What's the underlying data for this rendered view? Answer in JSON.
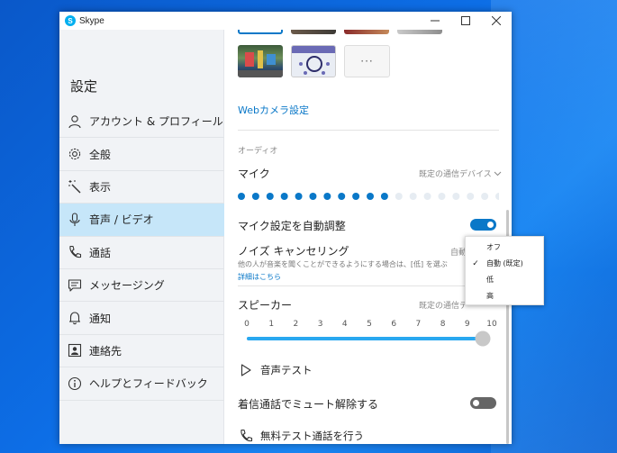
{
  "window": {
    "title": "Skype",
    "logo_letter": "S",
    "controls": {
      "minimize": "—",
      "maximize": "☐",
      "close": "✕"
    }
  },
  "sidebar": {
    "title": "設定",
    "items": [
      {
        "label": "アカウント & プロフィール",
        "icon": "person-icon",
        "active": false
      },
      {
        "label": "全般",
        "icon": "gear-icon",
        "active": false
      },
      {
        "label": "表示",
        "icon": "magic-wand-icon",
        "active": false
      },
      {
        "label": "音声 / ビデオ",
        "icon": "microphone-icon",
        "active": true
      },
      {
        "label": "通話",
        "icon": "phone-icon",
        "active": false
      },
      {
        "label": "メッセージング",
        "icon": "chat-icon",
        "active": false
      },
      {
        "label": "通知",
        "icon": "bell-icon",
        "active": false
      },
      {
        "label": "連絡先",
        "icon": "contact-card-icon",
        "active": false
      },
      {
        "label": "ヘルプとフィードバック",
        "icon": "info-icon",
        "active": false
      }
    ]
  },
  "video": {
    "more_label": "···",
    "webcam_settings_link": "Webカメラ設定"
  },
  "audio": {
    "section_label": "オーディオ",
    "mic": {
      "label": "マイク",
      "device": "既定の通信デバイス",
      "level_active_dots": 11,
      "level_total_dots": 19
    },
    "auto_adjust": {
      "label": "マイク設定を自動調整",
      "on": true
    },
    "noise": {
      "label": "ノイズ キャンセリング",
      "value_partial": "自動",
      "description": "他の人が音楽を聞くことができるようにする場合は、[低] を選ぶ",
      "learn_more": "詳細はこちら"
    },
    "speaker": {
      "label": "スピーカー",
      "device": "既定の通信デ",
      "ticks": [
        "0",
        "1",
        "2",
        "3",
        "4",
        "5",
        "6",
        "7",
        "8",
        "9",
        "10"
      ],
      "volume": 10,
      "volume_max": 10
    },
    "sound_test": "音声テスト",
    "unmute_incoming": {
      "label": "着信通話でミュート解除する",
      "on": false
    },
    "free_test_call": "無料テスト通話を行う"
  },
  "noise_menu": {
    "options": [
      {
        "label": "オフ",
        "checked": false
      },
      {
        "label": "自動 (既定)",
        "checked": true
      },
      {
        "label": "低",
        "checked": false
      },
      {
        "label": "高",
        "checked": false
      }
    ],
    "check_glyph": "✓"
  },
  "colors": {
    "accent": "#0a78c8",
    "active_nav": "#c6e6f9",
    "slider_track": "#29a8f0",
    "meter_inactive": "#e6ecf2"
  }
}
